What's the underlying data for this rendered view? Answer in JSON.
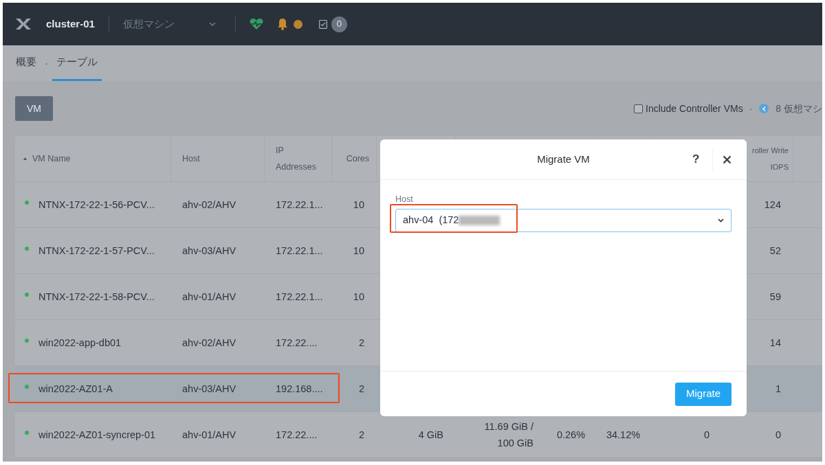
{
  "top_bar": {
    "cluster": "cluster-01",
    "view": "仮想マシン",
    "alert_count": "0"
  },
  "tabs": [
    {
      "label": "概要",
      "selected": false
    },
    {
      "label": "テーブル",
      "selected": true
    }
  ],
  "tab_separator": "·",
  "toolbar": {
    "button": "VM",
    "include_controller_vms": {
      "label": "Include Controller VMs",
      "checked": false
    },
    "separator": "·",
    "count": "8 仮想マシ"
  },
  "table": {
    "columns": [
      {
        "label": "VM Name",
        "sorted": true
      },
      {
        "label": "Host",
        "sorted": false
      },
      {
        "label": "IP Addresses",
        "sorted": false
      },
      {
        "label": "Cores",
        "sorted": false
      },
      {
        "label": "roller Write IOPS",
        "sorted": false
      }
    ],
    "rows": [
      {
        "cells": [
          "NTNX-172-22-1-56-PCV...",
          "ahv-02/AHV",
          "172.22.1...",
          "10",
          "124"
        ],
        "color": "#3aaa5a",
        "selected": false
      },
      {
        "cells": [
          "NTNX-172-22-1-57-PCV...",
          "ahv-03/AHV",
          "172.22.1...",
          "10",
          "52"
        ],
        "color": "#3aaa5a",
        "selected": false
      },
      {
        "cells": [
          "NTNX-172-22-1-58-PCV...",
          "ahv-01/AHV",
          "172.22.1...",
          "10",
          "59"
        ],
        "color": "#3aaa5a",
        "selected": false
      },
      {
        "cells": [
          "win2022-app-db01",
          "ahv-02/AHV",
          "172.22....",
          "2",
          "14"
        ],
        "color": "#3aaa5a",
        "selected": false
      },
      {
        "cells": [
          "win2022-AZ01-A",
          "ahv-03/AHV",
          "192.168....",
          "2",
          "1"
        ],
        "color": "#3aaa5a",
        "selected": true,
        "highlighted": true
      },
      {
        "cells": [
          "win2022-AZ01-syncrep-01",
          "ahv-01/AHV",
          "172.22....",
          "2",
          "4 GiB",
          "11.69 GiB / 100 GiB",
          "0.26%",
          "34.12%",
          "0",
          "0"
        ],
        "color": "#3aaa5a",
        "selected": false
      }
    ]
  },
  "dialog": {
    "title": "Migrate VM",
    "help": "?",
    "field_label": "Host",
    "field_value": "ahv-04  (172",
    "field_redacted": true,
    "field_highlighted": true,
    "button": "Migrate"
  }
}
